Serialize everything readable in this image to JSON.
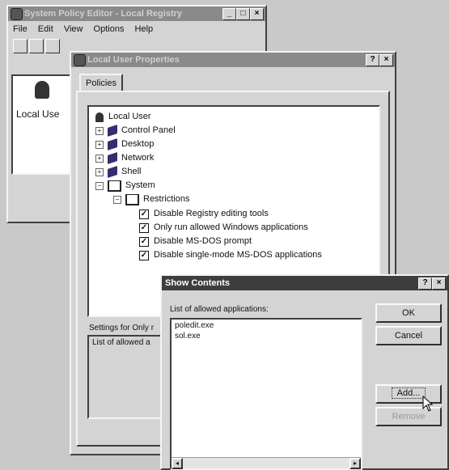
{
  "editor": {
    "title": "System Policy Editor - Local Registry",
    "menu": [
      "File",
      "Edit",
      "View",
      "Options",
      "Help"
    ],
    "icon_label": "Local Use"
  },
  "props": {
    "title": "Local User Properties",
    "tab": "Policies",
    "root": "Local User",
    "items": [
      {
        "label": "Control Panel",
        "icon": "book-closed-icon"
      },
      {
        "label": "Desktop",
        "icon": "book-closed-icon"
      },
      {
        "label": "Network",
        "icon": "book-closed-icon"
      },
      {
        "label": "Shell",
        "icon": "book-closed-icon"
      },
      {
        "label": "System",
        "icon": "book-open-icon"
      }
    ],
    "sub": "Restrictions",
    "checks": [
      "Disable Registry editing tools",
      "Only run allowed Windows applications",
      "Disable MS-DOS prompt",
      "Disable single-mode MS-DOS applications"
    ],
    "settings_label": "Settings for Only r",
    "settings_text": "List of allowed a"
  },
  "dialog": {
    "title": "Show Contents",
    "list_label": "List of allowed applications:",
    "entries": [
      "poledit.exe",
      "sol.exe"
    ],
    "ok": "OK",
    "cancel": "Cancel",
    "add": "Add...",
    "remove": "Remove"
  }
}
